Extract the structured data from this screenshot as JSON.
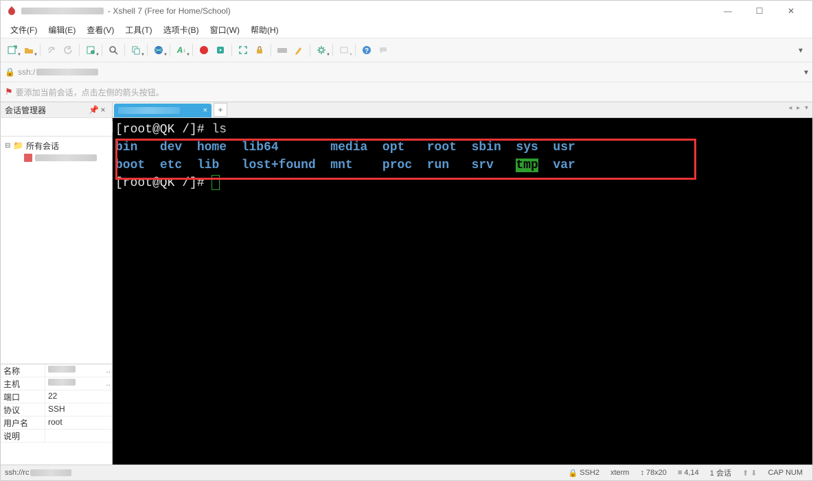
{
  "title_suffix": "- Xshell 7 (Free for Home/School)",
  "window_controls": {
    "min": "—",
    "max": "☐",
    "close": "✕"
  },
  "menus": [
    "文件(F)",
    "编辑(E)",
    "查看(V)",
    "工具(T)",
    "选项卡(B)",
    "窗口(W)",
    "帮助(H)"
  ],
  "address_prefix": "ssh:/",
  "hint_text": "要添加当前会话，点击左侧的箭头按钮。",
  "sidebar": {
    "title": "会话管理器",
    "search_placeholder": "",
    "root_label": "所有会话"
  },
  "properties": {
    "rows": [
      {
        "k": "名称",
        "v": ""
      },
      {
        "k": "主机",
        "v": ""
      },
      {
        "k": "端口",
        "v": "22"
      },
      {
        "k": "协议",
        "v": "SSH"
      },
      {
        "k": "用户名",
        "v": "root"
      },
      {
        "k": "说明",
        "v": ""
      }
    ]
  },
  "tabstrip": {
    "add": "+",
    "nav": "◂ ▸ ▾"
  },
  "terminal": {
    "prompt": "[root@QK /]# ",
    "cmd": "ls",
    "cols": [
      "bin",
      "dev",
      "home",
      "lib64",
      "media",
      "opt",
      "root",
      "sbin",
      "sys",
      "usr"
    ],
    "cols2": [
      "boot",
      "etc",
      "lib",
      "lost+found",
      "mnt",
      "proc",
      "run",
      "srv",
      "tmp",
      "var"
    ],
    "prompt2": "[root@QK /]# "
  },
  "status": {
    "left": "ssh://rc",
    "ssh": "SSH2",
    "term": "xterm",
    "size": "78x20",
    "pos": "4,14",
    "sess": "1 会话",
    "caps": "CAP  NUM"
  },
  "watermark": ""
}
